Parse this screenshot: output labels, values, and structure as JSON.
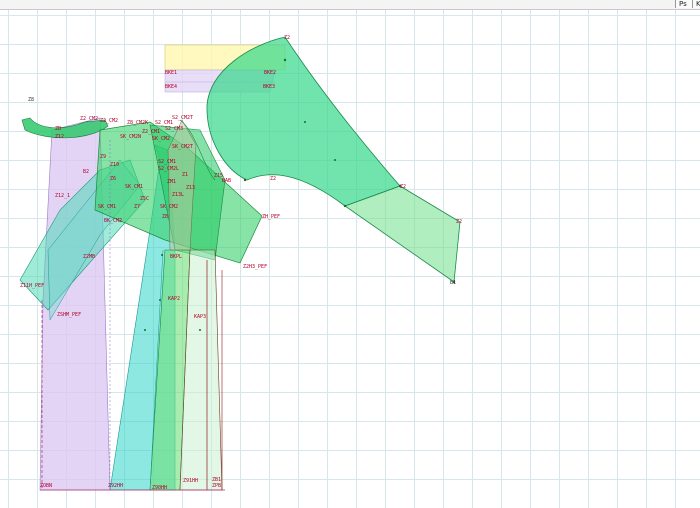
{
  "toolbar": {
    "buttons": [
      {
        "label": "Ps"
      },
      {
        "label": "K"
      }
    ]
  },
  "canvas": {
    "grid": true,
    "colors": {
      "background": "#ffffff",
      "grid": "#d6e6ea",
      "green_piece": "#2ed86a",
      "cyan_piece": "#2fd6c8",
      "lavender_piece": "#d9c6f2",
      "yellow_piece": "#fff59a",
      "label": "#b4002a"
    },
    "labels": [
      "Z2",
      "BKE2",
      "BKE3",
      "BKE1",
      "BKE4",
      "Z8",
      "ZB",
      "Z12",
      "Z2_CM2",
      "Z8_CM2K",
      "Z2_CM2",
      "S2_CM1",
      "S2_CM2T",
      "S2_CM3",
      "Z2_CM1",
      "SK_CM2N",
      "SK_CM2",
      "SK_CM2T",
      "Z9",
      "Z10",
      "S2_CM1",
      "S2_CM2L",
      "Z1",
      "ZM1",
      "Z13",
      "Z15",
      "BAB",
      "Z12_1",
      "B2",
      "Z6",
      "SK_CM1",
      "Z5C",
      "SK_CM1",
      "Z13L",
      "SK_CM2",
      "BK_CM2",
      "Z7",
      "Z8",
      "Z2",
      "Z2",
      "Z2",
      "B1",
      "ZH_PEF",
      "Z2MB",
      "BKPL",
      "Z11H_PEF",
      "ZSHM_PEF",
      "Z2H3_PEF",
      "KAP2",
      "KAP3",
      "ZOBN",
      "Z92HH",
      "Z90HH",
      "Z91HH",
      "ZPB",
      "ZB1"
    ]
  }
}
